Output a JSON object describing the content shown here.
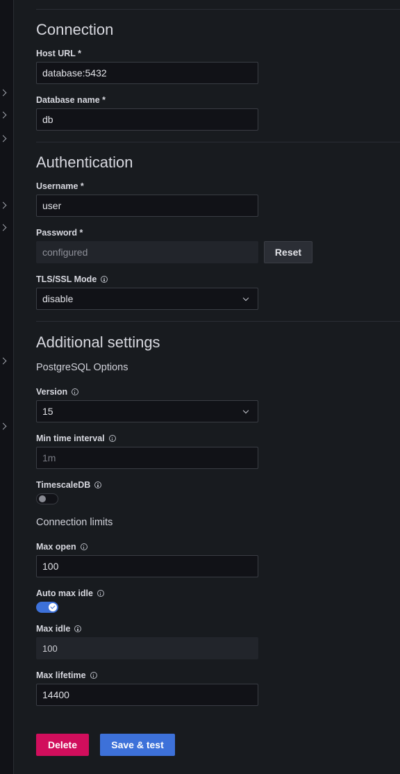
{
  "sections": {
    "connection": {
      "title": "Connection",
      "host_label": "Host URL *",
      "host_value": "database:5432",
      "dbname_label": "Database name *",
      "dbname_value": "db"
    },
    "authentication": {
      "title": "Authentication",
      "username_label": "Username *",
      "username_value": "user",
      "password_label": "Password *",
      "password_value": "configured",
      "reset_label": "Reset",
      "tls_label": "TLS/SSL Mode",
      "tls_value": "disable"
    },
    "additional": {
      "title": "Additional settings",
      "postgres_heading": "PostgreSQL Options",
      "version_label": "Version",
      "version_value": "15",
      "min_interval_label": "Min time interval",
      "min_interval_placeholder": "1m",
      "timescale_label": "TimescaleDB",
      "timescale_enabled": false,
      "limits_heading": "Connection limits",
      "max_open_label": "Max open",
      "max_open_value": "100",
      "auto_max_idle_label": "Auto max idle",
      "auto_max_idle_enabled": true,
      "max_idle_label": "Max idle",
      "max_idle_value": "100",
      "max_lifetime_label": "Max lifetime",
      "max_lifetime_value": "14400"
    }
  },
  "actions": {
    "delete_label": "Delete",
    "save_label": "Save & test"
  },
  "colors": {
    "background": "#181b1f",
    "input_bg": "#111217",
    "primary": "#3d71d9",
    "destructive": "#d10e5c"
  },
  "icons": {
    "info": "info-circle-icon",
    "dropdown": "chevron-down-icon",
    "sidebar_expand": "chevron-right-icon"
  }
}
